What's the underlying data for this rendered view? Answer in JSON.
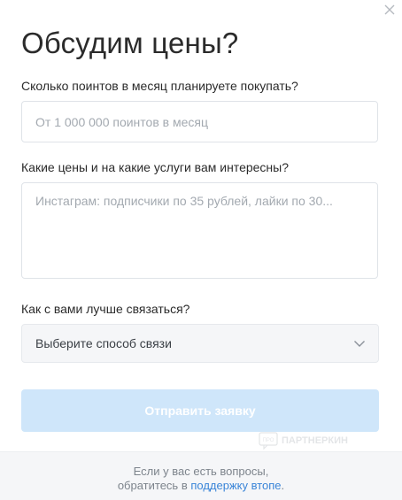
{
  "modal": {
    "title": "Обсудим цены?"
  },
  "form": {
    "points": {
      "label": "Сколько поинтов в месяц планируете покупать?",
      "placeholder": "От 1 000 000 поинтов в месяц"
    },
    "prices": {
      "label": "Какие цены и на какие услуги вам интересны?",
      "placeholder": "Инстаграм: подписчики по 35 рублей, лайки по 30..."
    },
    "contact": {
      "label": "Как с вами лучше связаться?",
      "selected": "Выберите способ связи"
    },
    "submit_label": "Отправить заявку"
  },
  "watermark": {
    "text": "ПАРТНЕРКИН",
    "badge": "ПРО"
  },
  "footer": {
    "line1": "Если у вас есть вопросы,",
    "line2_prefix": "обратитесь в ",
    "link": "поддержку втопе",
    "line2_suffix": "."
  },
  "colors": {
    "accent": "#3a85d8",
    "submit_bg": "#cfe6fa",
    "footer_bg": "#f5f6f8"
  },
  "icons": {
    "close": "close-icon",
    "chevron": "chevron-down-icon"
  }
}
